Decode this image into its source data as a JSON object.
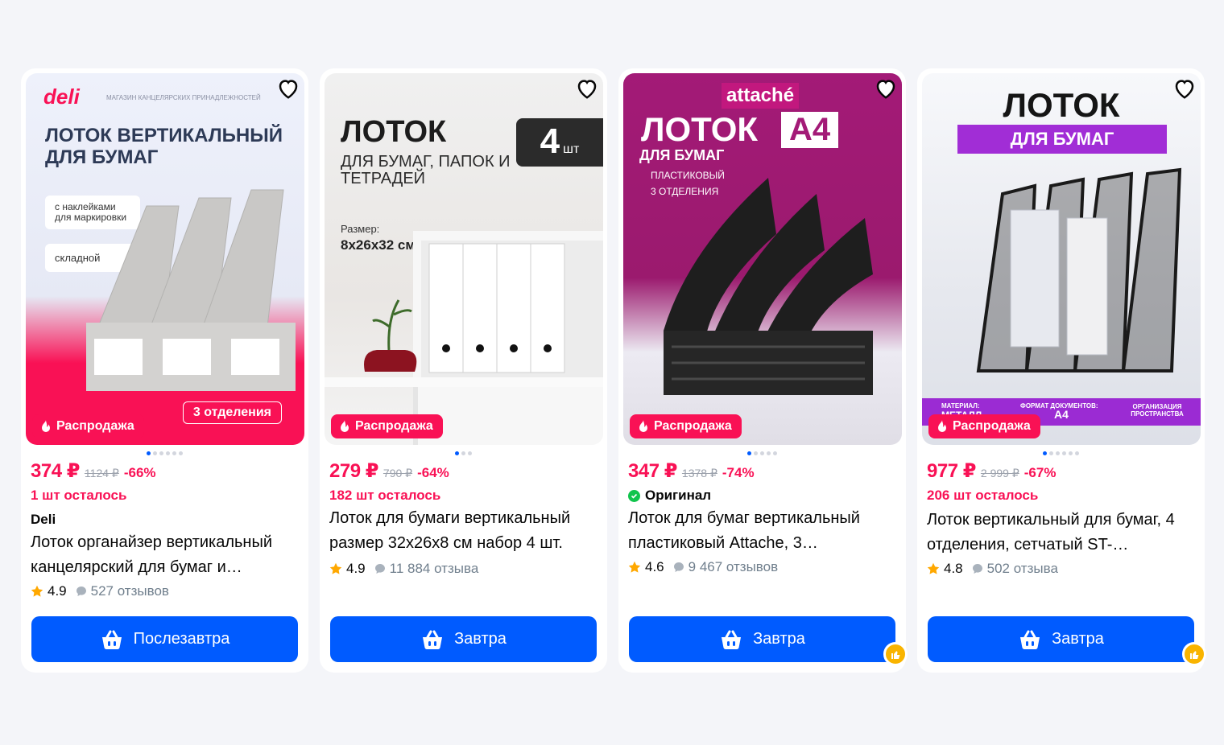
{
  "products": [
    {
      "badge": "Распродажа",
      "price": "374 ₽",
      "old_price": "1124 ₽",
      "discount": "-66%",
      "stock": "1 шт осталось",
      "brand": "Deli",
      "title": "Лоток органайзер вертикальный канцелярский для бумаг и…",
      "rating": "4.9",
      "reviews": "527 отзывов",
      "delivery": "Послезавтра",
      "photo": {
        "logo": "deli",
        "store": "МАГАЗИН КАНЦЕЛЯРСКИХ ПРИНАДЛЕЖНОСТЕЙ",
        "headline": "ЛОТОК ВЕРТИКАЛЬНЫЙ ДЛЯ БУМАГ",
        "tag1": "с наклейками для маркировки",
        "tag2": "складной",
        "sections": "3 отделения"
      }
    },
    {
      "badge": "Распродажа",
      "price": "279 ₽",
      "old_price": "790 ₽",
      "discount": "-64%",
      "stock": "182 шт осталось",
      "title": "Лоток для бумаги вертикальный размер 32х26х8 см набор 4 шт.",
      "rating": "4.9",
      "reviews": "11 884 отзыва",
      "delivery": "Завтра",
      "photo": {
        "headline": "ЛОТОК",
        "sub": "ДЛЯ БУМАГ, ПАПОК И ТЕТРАДЕЙ",
        "count": "4",
        "count_unit": "шт",
        "size_label": "Размер:",
        "size": "8х26х32 см"
      }
    },
    {
      "badge": "Распродажа",
      "price": "347 ₽",
      "old_price": "1378 ₽",
      "discount": "-74%",
      "original": "Оригинал",
      "title": "Лоток для бумаг вертикальный пластиковый Attache, 3…",
      "rating": "4.6",
      "reviews": "9 467 отзывов",
      "delivery": "Завтра",
      "photo": {
        "logo": "attaché",
        "headline": "ЛОТОК",
        "format": "А4",
        "sub": "ДЛЯ БУМАГ",
        "bullet1": "ПЛАСТИКОВЫЙ",
        "bullet2": "3 ОТДЕЛЕНИЯ"
      }
    },
    {
      "badge": "Распродажа",
      "price": "977 ₽",
      "old_price": "2 999 ₽",
      "discount": "-67%",
      "stock": "206 шт осталось",
      "title": "Лоток вертикальный для бумаг, 4 отделения, сетчатый ST-…",
      "rating": "4.8",
      "reviews": "502 отзыва",
      "delivery": "Завтра",
      "photo": {
        "headline": "ЛОТОК",
        "sub": "ДЛЯ БУМАГ",
        "f1_label": "МАТЕРИАЛ:",
        "f1": "МЕТАЛЛ",
        "f2_label": "ФОРМАТ ДОКУМЕНТОВ:",
        "f2": "А4",
        "f3": "ОРГАНИЗАЦИЯ ПРОСТРАНСТВА"
      }
    }
  ],
  "colors": {
    "accent": "#005bff",
    "sale": "#f91155",
    "muted": "#707f8d",
    "star": "#ffa800"
  }
}
